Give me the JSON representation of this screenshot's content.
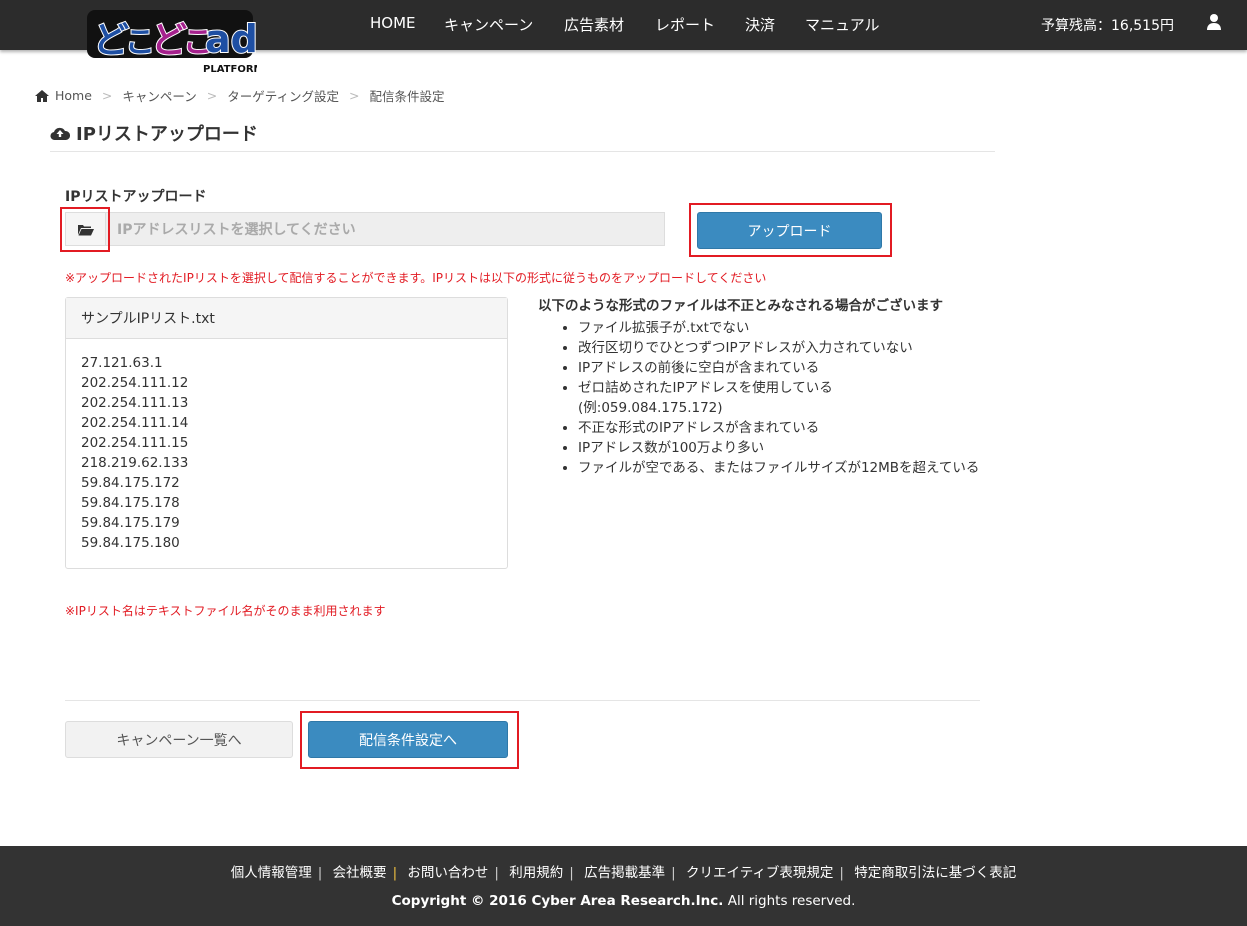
{
  "header": {
    "logo_text": "どこどこad",
    "logo_sub": "PLATFORM",
    "nav": [
      "HOME",
      "キャンペーン",
      "広告素材",
      "レポート",
      "決済",
      "マニュアル"
    ],
    "budget": "予算残高：16,515円"
  },
  "breadcrumb": [
    "Home",
    "キャンペーン",
    "ターゲティング設定",
    "配信条件設定"
  ],
  "page_title": "IPリストアップロード",
  "upload": {
    "label": "IPリストアップロード",
    "placeholder": "IPアドレスリストを選択してください",
    "button": "アップロード",
    "note": "※アップロードされたIPリストを選択して配信することができます。IPリストは以下の形式に従うものをアップロードしてください"
  },
  "sample": {
    "title": "サンプルIPリスト.txt",
    "ips": [
      "27.121.63.1",
      "202.254.111.12",
      "202.254.111.13",
      "202.254.111.14",
      "202.254.111.15",
      "218.219.62.133",
      "59.84.175.172",
      "59.84.175.178",
      "59.84.175.179",
      "59.84.175.180"
    ]
  },
  "invalid": {
    "heading": "以下のような形式のファイルは不正とみなされる場合がございます",
    "items": [
      "ファイル拡張子が.txtでない",
      "改行区切りでひとつずつIPアドレスが入力されていない",
      "IPアドレスの前後に空白が含まれている",
      "ゼロ詰めされたIPアドレスを使用している(例:059.084.175.172)",
      "不正な形式のIPアドレスが含まれている",
      "IPアドレス数が100万より多い",
      "ファイルが空である、またはファイルサイズが12MBを超えている"
    ]
  },
  "name_note": "※IPリスト名はテキストファイル名がそのまま利用されます",
  "actions": {
    "back": "キャンペーン一覧へ",
    "next": "配信条件設定へ"
  },
  "footer": {
    "links": [
      "個人情報管理",
      "会社概要",
      "お問い合わせ",
      "利用規約",
      "広告掲載基準",
      "クリエイティブ表現規定",
      "特定商取引法に基づく表記"
    ],
    "copyright_bold": "Copyright © 2016 Cyber Area Research.Inc.",
    "copyright_rest": " All rights reserved."
  },
  "colors": {
    "header_bg": "#2c2c2c",
    "primary": "#3b8bc0",
    "highlight": "#e21b23",
    "note": "#e21b23"
  }
}
